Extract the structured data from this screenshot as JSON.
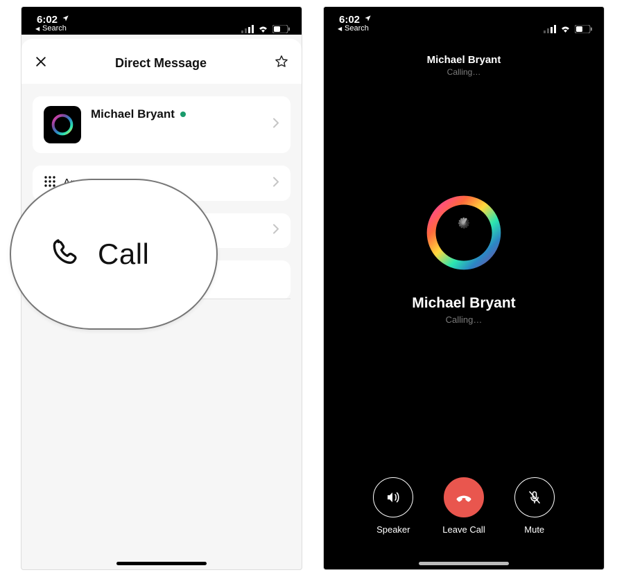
{
  "statusbar": {
    "time": "6:02",
    "back_label": "Search"
  },
  "left": {
    "header_title": "Direct Message",
    "user": {
      "name": "Michael Bryant"
    },
    "rows": {
      "apps_label": "Apps"
    }
  },
  "callout": {
    "label": "Call"
  },
  "right": {
    "top_name": "Michael Bryant",
    "top_status": "Calling…",
    "center_name": "Michael Bryant",
    "center_status": "Calling…",
    "controls": {
      "speaker": "Speaker",
      "leave": "Leave Call",
      "mute": "Mute"
    }
  }
}
